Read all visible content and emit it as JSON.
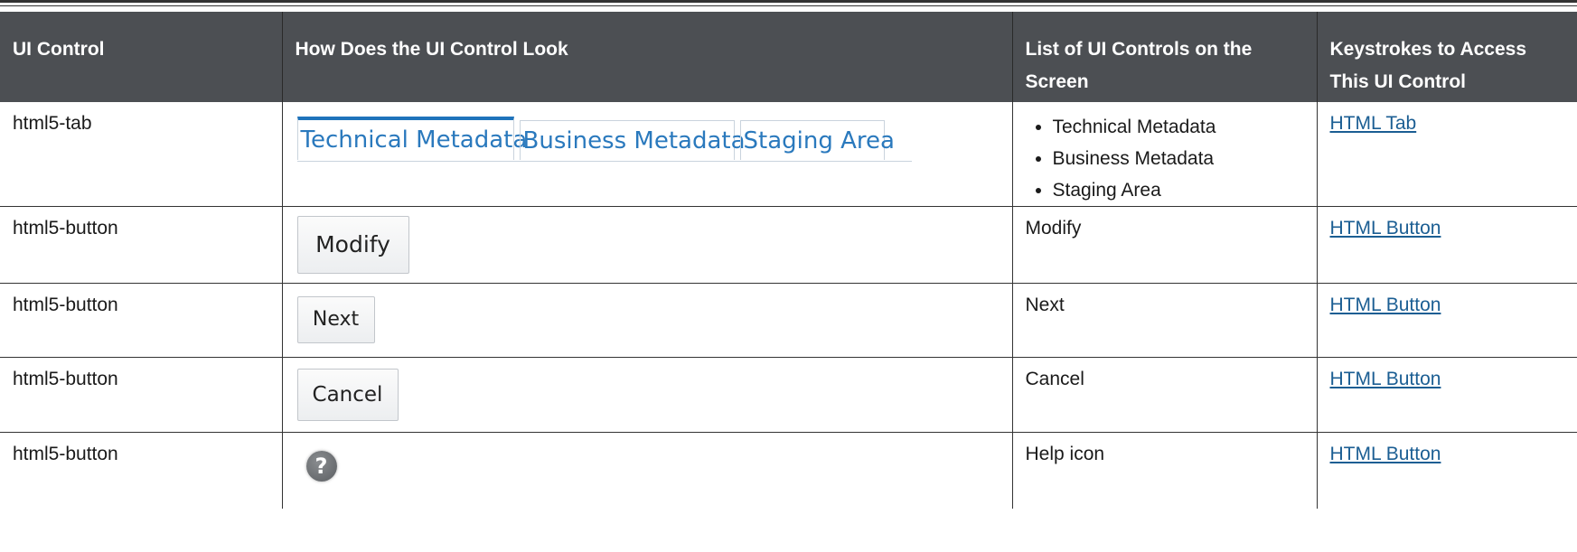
{
  "header": {
    "col1": "UI Control",
    "col2": "How Does the UI Control Look",
    "col3": "List of UI Controls on the Screen",
    "col4": "Keystrokes to Access This UI Control"
  },
  "rows": [
    {
      "control": "html5-tab",
      "look_tabs": [
        "Technical Metadata",
        "Business Metadata",
        "Staging Area"
      ],
      "list": [
        "Technical Metadata",
        "Business Metadata",
        "Staging Area"
      ],
      "link": "HTML Tab"
    },
    {
      "control": "html5-button",
      "look": "Modify",
      "list": "Modify",
      "link": "HTML Button"
    },
    {
      "control": "html5-button",
      "look": "Next",
      "list": "Next",
      "link": "HTML Button"
    },
    {
      "control": "html5-button",
      "look": "Cancel",
      "list": "Cancel",
      "link": "HTML Button"
    },
    {
      "control": "html5-button",
      "look_icon": "help-icon",
      "list": "Help icon",
      "link": "HTML Button"
    }
  ],
  "colors": {
    "header_bg": "#4c4f53",
    "link": "#1b5e93",
    "tab_text": "#2a79bd",
    "tab_active": "#1f73bb"
  }
}
